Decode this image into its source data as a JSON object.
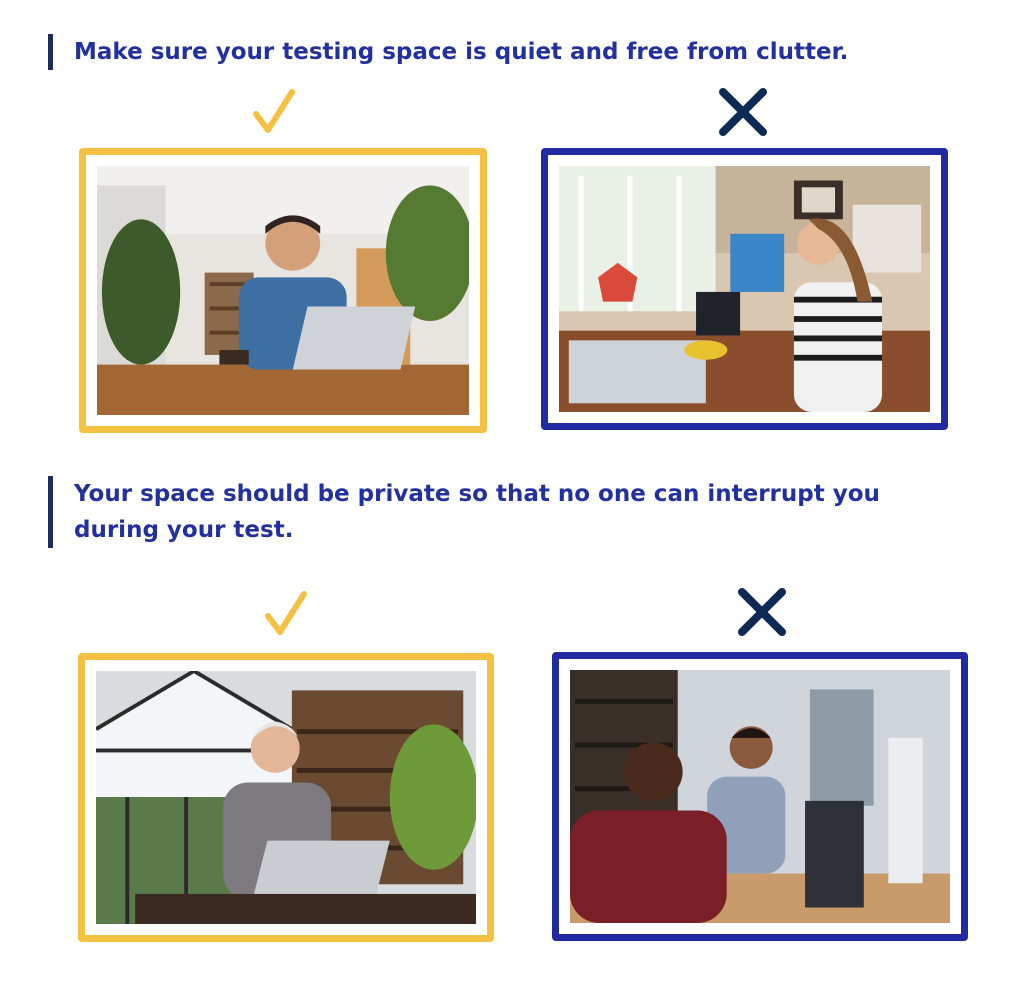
{
  "sections": [
    {
      "heading": "Make sure your testing space is quiet and free from clutter.",
      "good_example": {
        "mark_icon": "checkmark-icon",
        "frame_color": "#f5c143"
      },
      "bad_example": {
        "mark_icon": "x-icon",
        "frame_color": "#1f2aa3"
      }
    },
    {
      "heading": "Your space should be private so that no one can interrupt you during your test.",
      "good_example": {
        "mark_icon": "checkmark-icon",
        "frame_color": "#f5c143"
      },
      "bad_example": {
        "mark_icon": "x-icon",
        "frame_color": "#1f2aa3"
      }
    }
  ],
  "colors": {
    "heading_text": "#23309f",
    "heading_bar": "#1e2d5a",
    "check_mark": "#f5c143",
    "x_mark": "#0d2a55"
  }
}
